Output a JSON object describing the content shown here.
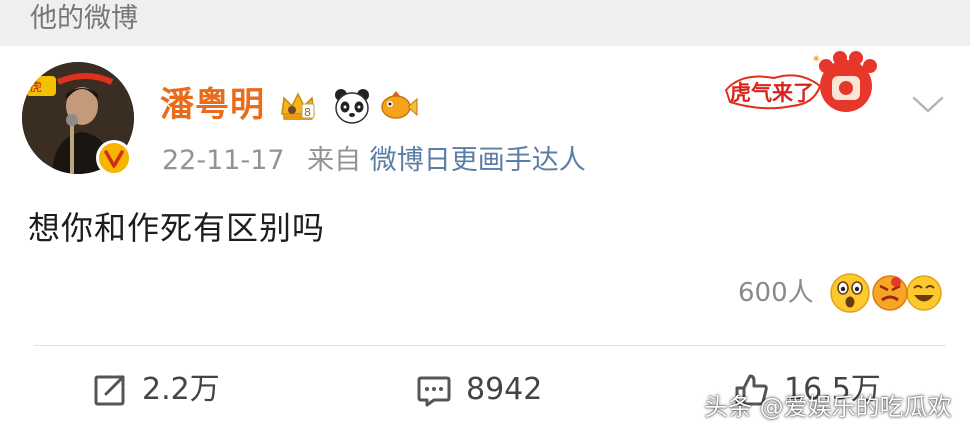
{
  "section_header": {
    "title": "他的微博"
  },
  "post": {
    "author": {
      "name": "潘粤明",
      "avatar_icon": "user-avatar",
      "verified_icon": "verified-v-icon",
      "badges": [
        "crown-badge-icon",
        "panda-badge-icon",
        "fish-badge-icon"
      ]
    },
    "meta": {
      "date": "22-11-17",
      "from_label": "来自",
      "source": "微博日更画手达人"
    },
    "decoration": {
      "banner_icon": "tiger-paw-banner-icon",
      "banner_text": "虎气来了"
    },
    "text": "想你和作死有区别吗",
    "reactions": {
      "count_label": "600人",
      "emojis": [
        "surprised-emoji-icon",
        "angry-emoji-icon",
        "laughing-emoji-icon"
      ]
    },
    "actions": {
      "repost": {
        "icon": "repost-icon",
        "label": "2.2万"
      },
      "comment": {
        "icon": "comment-icon",
        "label": "8942"
      },
      "like": {
        "icon": "like-icon",
        "label": "16.5万"
      }
    }
  },
  "watermark": {
    "text": "头条 @爱娱乐的吃瓜欢"
  },
  "colors": {
    "header_bg": "#efefef",
    "username": "#e86c1a",
    "source_link": "#5b7ea6",
    "meta_gray": "#939393",
    "badge_red": "#e0311f"
  }
}
